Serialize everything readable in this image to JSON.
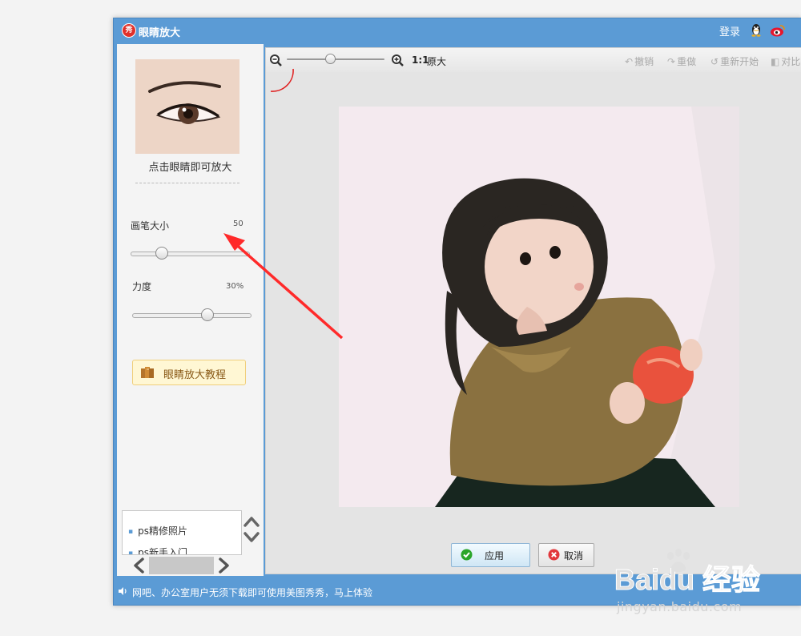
{
  "window": {
    "title": "眼睛放大",
    "logo_text": "秀",
    "login_label": "登录"
  },
  "sidebar": {
    "eye_hint": "点击眼睛即可放大",
    "brush_label": "画笔大小",
    "brush_value": "50",
    "strength_label": "力度",
    "strength_value": "30%",
    "tutorial_label": "眼睛放大教程",
    "links": [
      "ps精修照片",
      "ps新手入门"
    ]
  },
  "toolbar": {
    "ratio_label": "1:1",
    "original_label": "原大",
    "undo_label": "撤销",
    "redo_label": "重做",
    "restart_label": "重新开始",
    "compare_label": "对比"
  },
  "actions": {
    "apply_label": "应用",
    "cancel_label": "取消"
  },
  "status": {
    "text": "网吧、办公室用户无须下载即可使用美图秀秀，马上体验"
  },
  "watermark": {
    "logo_text": "Baidu 经验",
    "url": "jingyan.baidu.com"
  },
  "colors": {
    "chrome_blue": "#5b9bd5",
    "annotation_red": "#ff2a2a",
    "apply_check_green": "#2aa52a",
    "cancel_x_red": "#e2383c"
  }
}
